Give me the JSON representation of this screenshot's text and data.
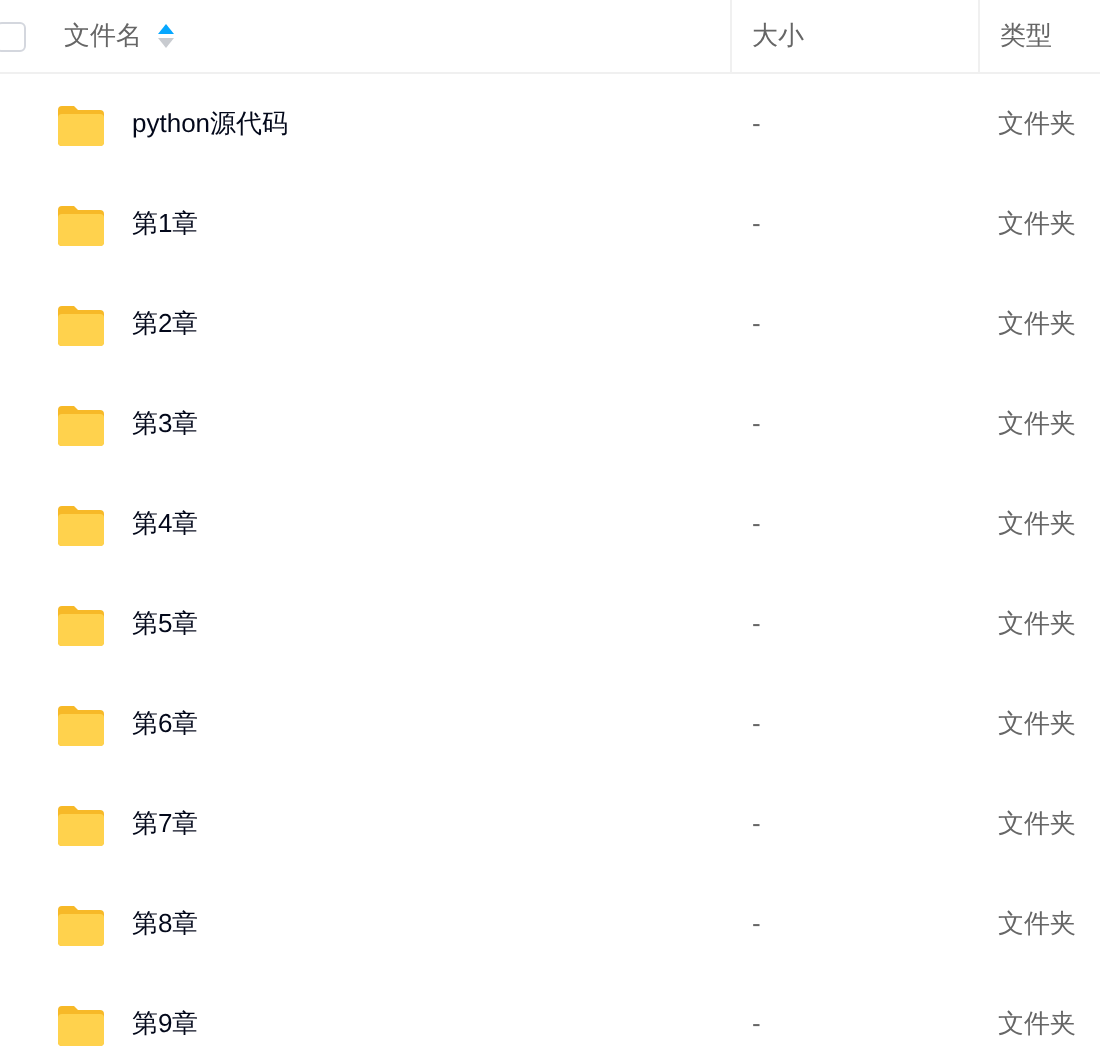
{
  "header": {
    "select_all": {
      "checked": false
    },
    "columns": [
      {
        "label": "文件名",
        "sorted_ascending": true
      },
      {
        "label": "大小"
      },
      {
        "label": "类型"
      }
    ]
  },
  "rows": [
    {
      "name": "python源代码",
      "size": "-",
      "type": "文件夹"
    },
    {
      "name": "第1章",
      "size": "-",
      "type": "文件夹"
    },
    {
      "name": "第2章",
      "size": "-",
      "type": "文件夹"
    },
    {
      "name": "第3章",
      "size": "-",
      "type": "文件夹"
    },
    {
      "name": "第4章",
      "size": "-",
      "type": "文件夹"
    },
    {
      "name": "第5章",
      "size": "-",
      "type": "文件夹"
    },
    {
      "name": "第6章",
      "size": "-",
      "type": "文件夹"
    },
    {
      "name": "第7章",
      "size": "-",
      "type": "文件夹"
    },
    {
      "name": "第8章",
      "size": "-",
      "type": "文件夹"
    },
    {
      "name": "第9章",
      "size": "-",
      "type": "文件夹"
    }
  ]
}
